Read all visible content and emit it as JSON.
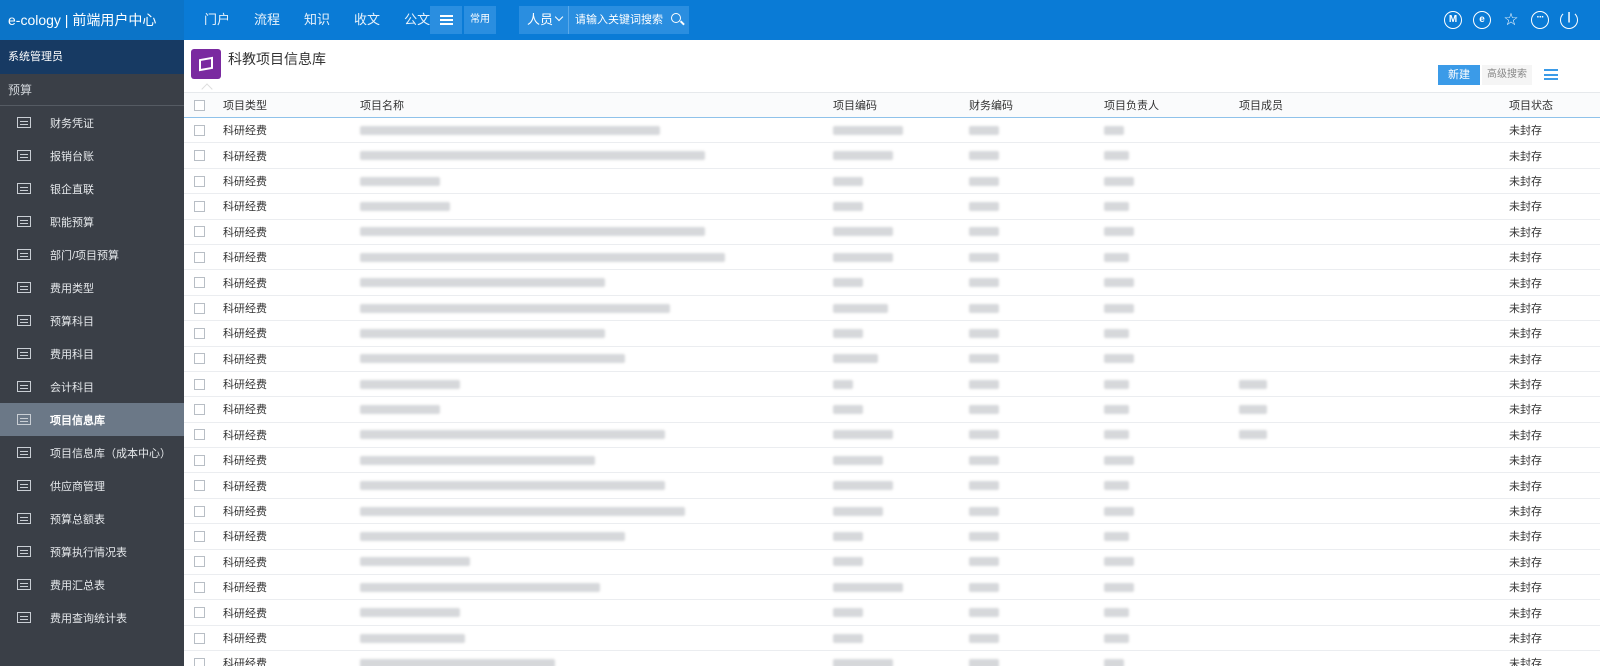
{
  "app": {
    "brand": "e-cology | 前端用户中心",
    "nav": [
      "门户",
      "流程",
      "知识",
      "收文",
      "公文"
    ],
    "common_label": "常用",
    "search": {
      "type": "人员",
      "placeholder": "请输入关键词搜索"
    },
    "top_icons": [
      "m-icon",
      "e-icon",
      "star-icon",
      "more-icon",
      "power-icon"
    ]
  },
  "sidebar": {
    "admin": "系统管理员",
    "section": "预算",
    "active_index": 9,
    "items": [
      "财务凭证",
      "报销台账",
      "银企直联",
      "职能预算",
      "部门/项目预算",
      "费用类型",
      "预算科目",
      "费用科目",
      "会计科目",
      "项目信息库",
      "项目信息库（成本中心）",
      "供应商管理",
      "预算总额表",
      "预算执行情况表",
      "费用汇总表",
      "费用查询统计表"
    ]
  },
  "page": {
    "title": "科教项目信息库",
    "new_label": "新建",
    "adv_search_label": "高级搜索"
  },
  "table": {
    "columns": [
      "项目类型",
      "项目名称",
      "项目编码",
      "财务编码",
      "项目负责人",
      "项目成员",
      "项目状态"
    ],
    "rows": [
      {
        "type": "科研经费",
        "status": "未封存"
      },
      {
        "type": "科研经费",
        "status": "未封存"
      },
      {
        "type": "科研经费",
        "status": "未封存"
      },
      {
        "type": "科研经费",
        "status": "未封存"
      },
      {
        "type": "科研经费",
        "status": "未封存"
      },
      {
        "type": "科研经费",
        "status": "未封存"
      },
      {
        "type": "科研经费",
        "status": "未封存"
      },
      {
        "type": "科研经费",
        "status": "未封存"
      },
      {
        "type": "科研经费",
        "status": "未封存"
      },
      {
        "type": "科研经费",
        "status": "未封存"
      },
      {
        "type": "科研经费",
        "status": "未封存"
      },
      {
        "type": "科研经费",
        "status": "未封存"
      },
      {
        "type": "科研经费",
        "status": "未封存"
      },
      {
        "type": "科研经费",
        "status": "未封存"
      },
      {
        "type": "科研经费",
        "status": "未封存"
      },
      {
        "type": "科研经费",
        "status": "未封存"
      },
      {
        "type": "科研经费",
        "status": "未封存"
      },
      {
        "type": "科研经费",
        "status": "未封存"
      },
      {
        "type": "科研经费",
        "status": "未封存"
      },
      {
        "type": "科研经费",
        "status": "未封存"
      },
      {
        "type": "科研经费",
        "status": "未封存"
      },
      {
        "type": "科研经费",
        "status": "未封存"
      }
    ]
  },
  "colors": {
    "topbar": "#0a7bd6",
    "sidebar": "#3a3f47",
    "active_item": "#6b7887",
    "accent": "#3b9be8",
    "logo": "#7a2aa0"
  }
}
